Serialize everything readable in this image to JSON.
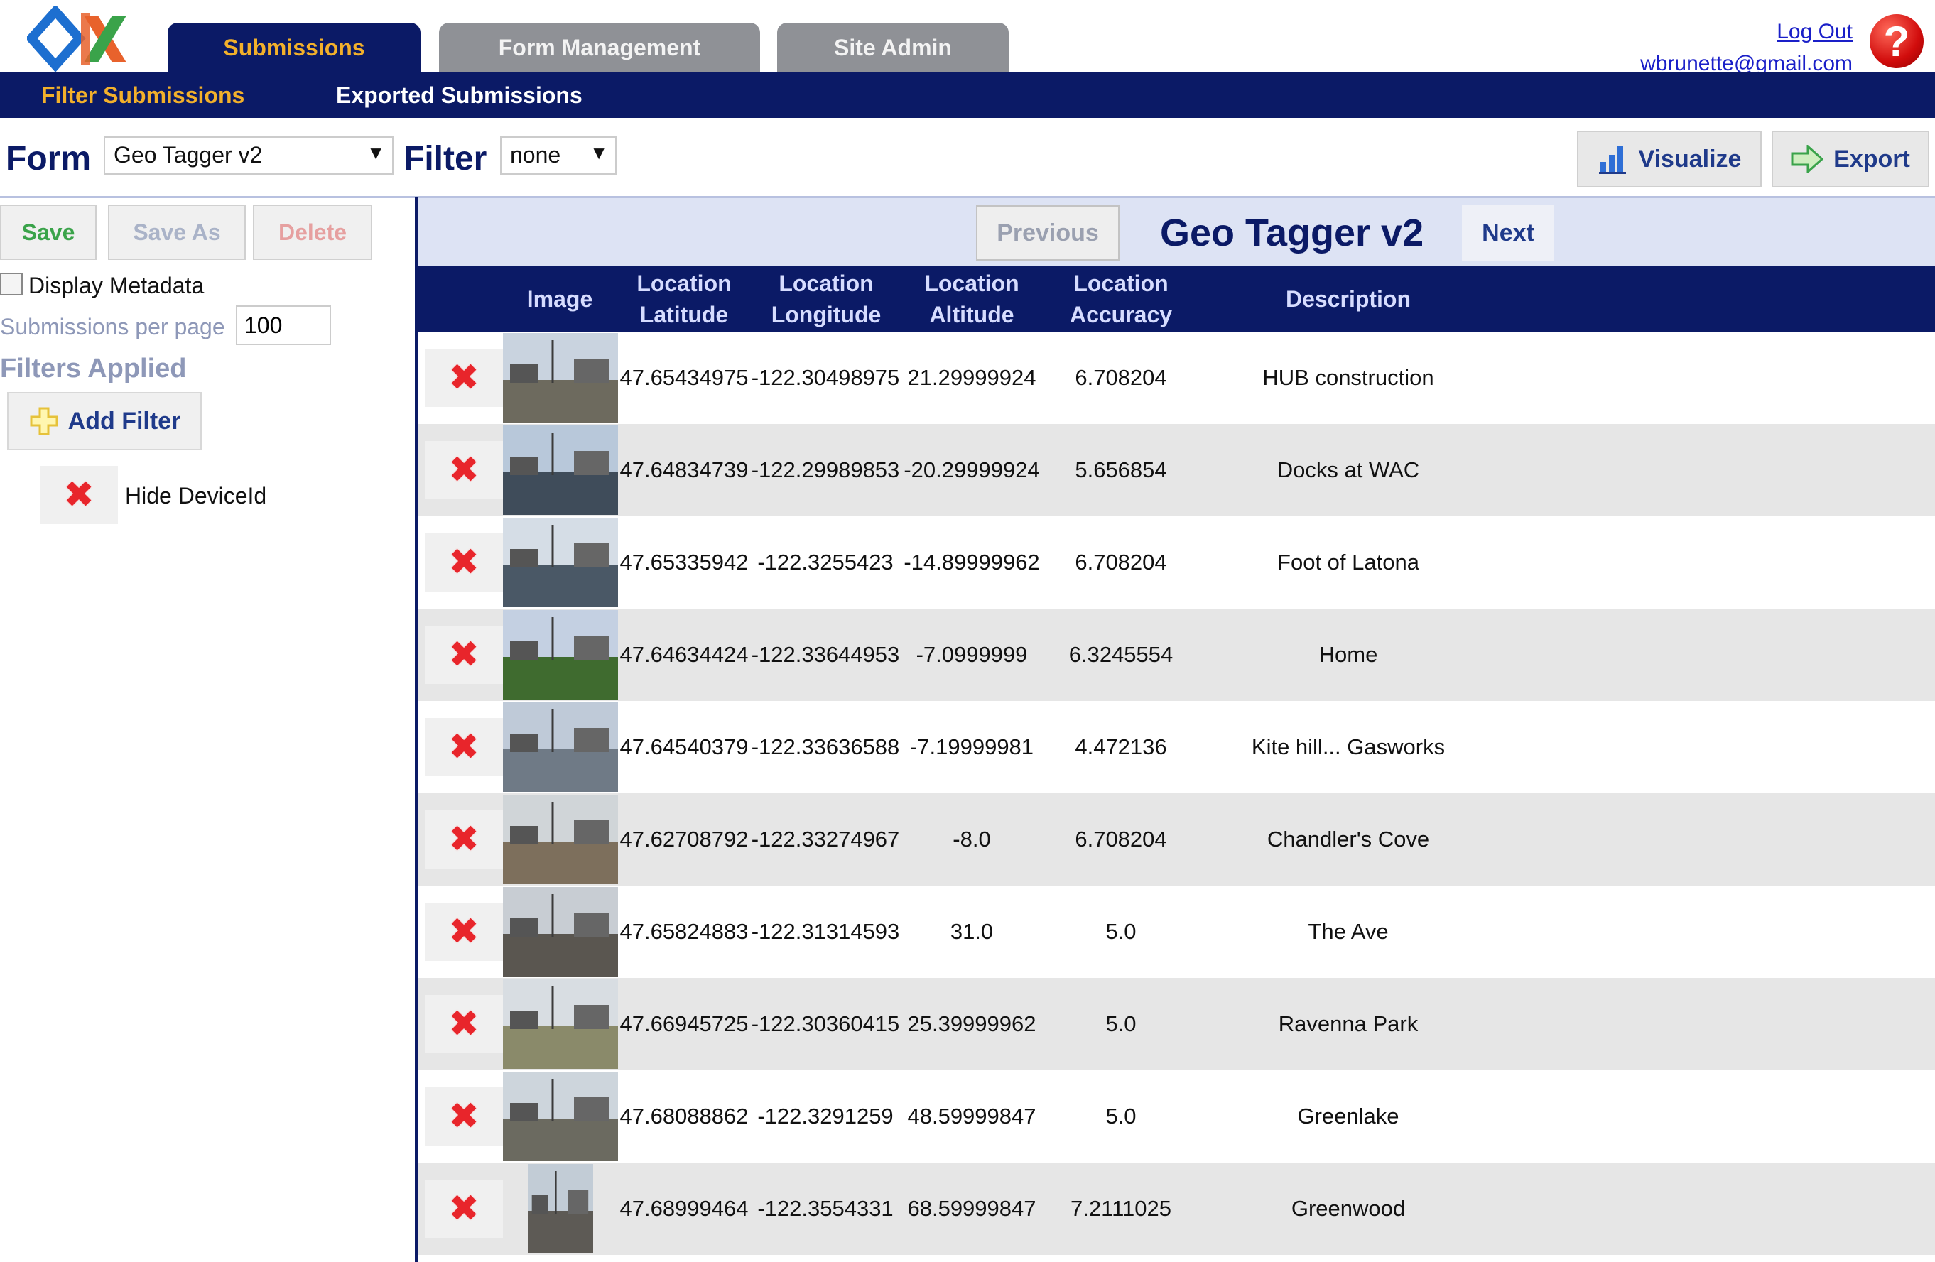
{
  "header": {
    "tabs": [
      {
        "label": "Submissions",
        "active": true
      },
      {
        "label": "Form Management",
        "active": false
      },
      {
        "label": "Site Admin",
        "active": false
      }
    ],
    "logout_label": "Log Out",
    "user_email": "wbrunette@gmail.com",
    "help_glyph": "?"
  },
  "subnav": {
    "items": [
      {
        "label": "Filter Submissions",
        "active": true
      },
      {
        "label": "Exported Submissions",
        "active": false
      }
    ]
  },
  "form_bar": {
    "form_label": "Form",
    "form_value": "Geo Tagger v2",
    "filter_label": "Filter",
    "filter_value": "none",
    "visualize_label": "Visualize",
    "export_label": "Export"
  },
  "sidebar": {
    "save_label": "Save",
    "save_as_label": "Save As",
    "delete_label": "Delete",
    "display_metadata_label": "Display Metadata",
    "display_metadata_checked": false,
    "per_page_label": "Submissions per page",
    "per_page_value": "100",
    "filters_applied_label": "Filters Applied",
    "add_filter_label": "Add Filter",
    "filters": [
      {
        "label": "Hide DeviceId"
      }
    ]
  },
  "main": {
    "title": "Geo Tagger v2",
    "previous_label": "Previous",
    "next_label": "Next",
    "columns": [
      "Image",
      "Location\nLatitude",
      "Location\nLongitude",
      "Location\nAltitude",
      "Location\nAccuracy",
      "Description"
    ],
    "rows": [
      {
        "lat": "47.65434975",
        "lon": "-122.30498975",
        "alt": "21.29999924",
        "acc": "6.708204",
        "desc": "HUB construction"
      },
      {
        "lat": "47.64834739",
        "lon": "-122.29989853",
        "alt": "-20.29999924",
        "acc": "5.656854",
        "desc": "Docks at WAC"
      },
      {
        "lat": "47.65335942",
        "lon": "-122.3255423",
        "alt": "-14.89999962",
        "acc": "6.708204",
        "desc": "Foot of Latona"
      },
      {
        "lat": "47.64634424",
        "lon": "-122.33644953",
        "alt": "-7.0999999",
        "acc": "6.3245554",
        "desc": "Home"
      },
      {
        "lat": "47.64540379",
        "lon": "-122.33636588",
        "alt": "-7.19999981",
        "acc": "4.472136",
        "desc": "Kite hill... Gasworks"
      },
      {
        "lat": "47.62708792",
        "lon": "-122.33274967",
        "alt": "-8.0",
        "acc": "6.708204",
        "desc": "Chandler's Cove"
      },
      {
        "lat": "47.65824883",
        "lon": "-122.31314593",
        "alt": "31.0",
        "acc": "5.0",
        "desc": "The Ave"
      },
      {
        "lat": "47.66945725",
        "lon": "-122.30360415",
        "alt": "25.39999962",
        "acc": "5.0",
        "desc": "Ravenna Park"
      },
      {
        "lat": "47.68088862",
        "lon": "-122.3291259",
        "alt": "48.59999847",
        "acc": "5.0",
        "desc": "Greenlake"
      },
      {
        "lat": "47.68999464",
        "lon": "-122.3554331",
        "alt": "68.59999847",
        "acc": "7.2111025",
        "desc": "Greenwood"
      }
    ],
    "delete_icon": "red-x-icon",
    "thumbnail_icon": "photo-thumbnail"
  },
  "colors": {
    "nav_navy": "#0b1a66",
    "accent_gold": "#f2b02b",
    "tab_gray": "#8f9196",
    "row_alt": "#e6e6e6",
    "delete_red": "#e8252b"
  }
}
